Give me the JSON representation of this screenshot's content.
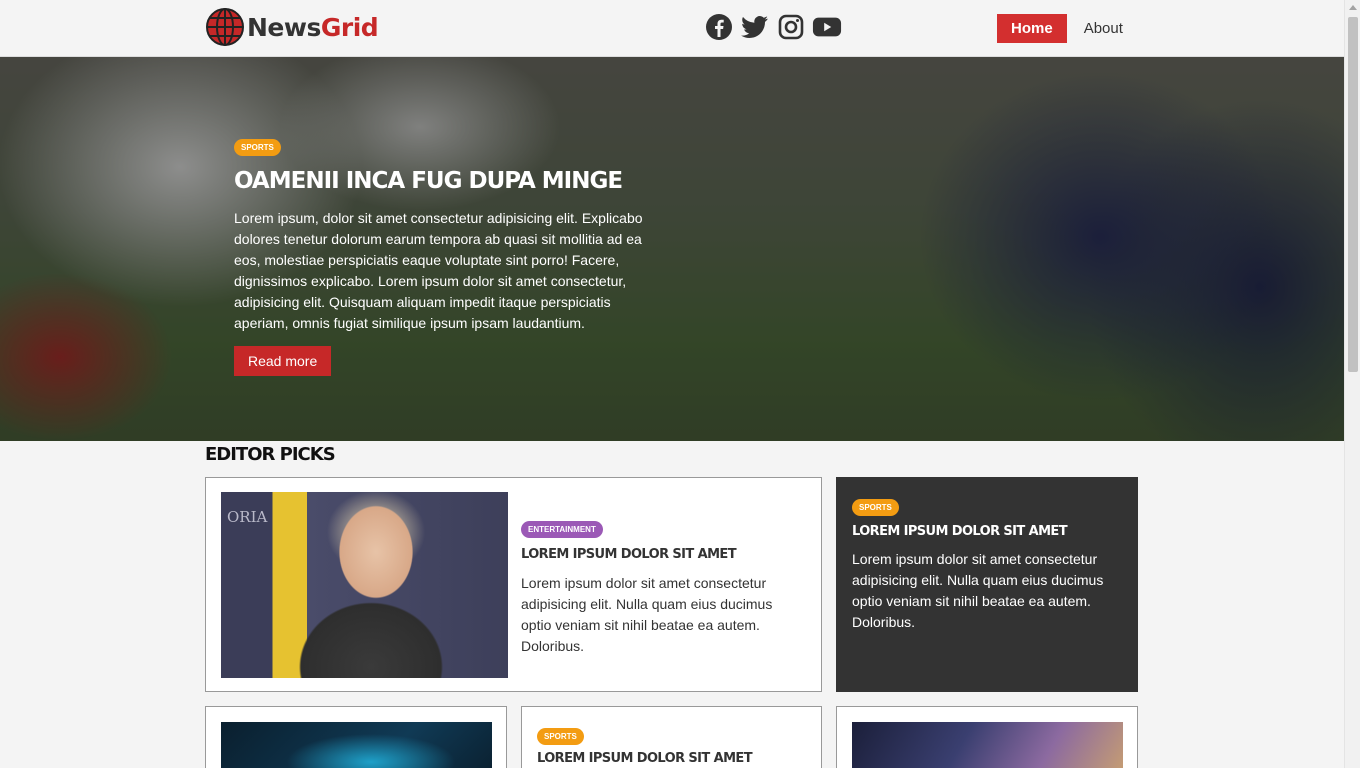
{
  "brand": {
    "part1": "News",
    "part2": "Grid"
  },
  "social": [
    "facebook-icon",
    "twitter-icon",
    "instagram-icon",
    "youtube-icon"
  ],
  "nav": {
    "home": "Home",
    "about": "About"
  },
  "hero": {
    "tag": "Sports",
    "title": "Oamenii inca fug dupa minge",
    "text": "Lorem ipsum, dolor sit amet consectetur adipisicing elit. Explicabo dolores tenetur dolorum earum tempora ab quasi sit mollitia ad ea eos, molestiae perspiciatis eaque voluptate sint porro! Facere, dignissimos explicabo. Lorem ipsum dolor sit amet consectetur, adipisicing elit. Quisquam aliquam impedit itaque perspiciatis aperiam, omnis fugiat similique ipsum ipsam laudantium.",
    "button": "Read more"
  },
  "editor_picks": {
    "heading": "Editor Picks",
    "cards": [
      {
        "tag": "Entertainment",
        "title": "Lorem ipsum dolor sit amet",
        "text": "Lorem ipsum dolor sit amet consectetur adipisicing elit. Nulla quam eius ducimus optio veniam sit nihil beatae ea autem. Doloribus.",
        "photo_text": "ORIA"
      },
      {
        "tag": "Sports",
        "title": "Lorem ipsum dolor sit amet",
        "text": "Lorem ipsum dolor sit amet consectetur adipisicing elit. Nulla quam eius ducimus optio veniam sit nihil beatae ea autem. Doloribus."
      },
      {
        "tag": "Sports",
        "title": "Lorem ipsum dolor sit amet"
      }
    ]
  },
  "colors": {
    "accent": "#c62828",
    "sports": "#f39c12",
    "entertainment": "#9b59b6",
    "dark_card": "#333333"
  }
}
